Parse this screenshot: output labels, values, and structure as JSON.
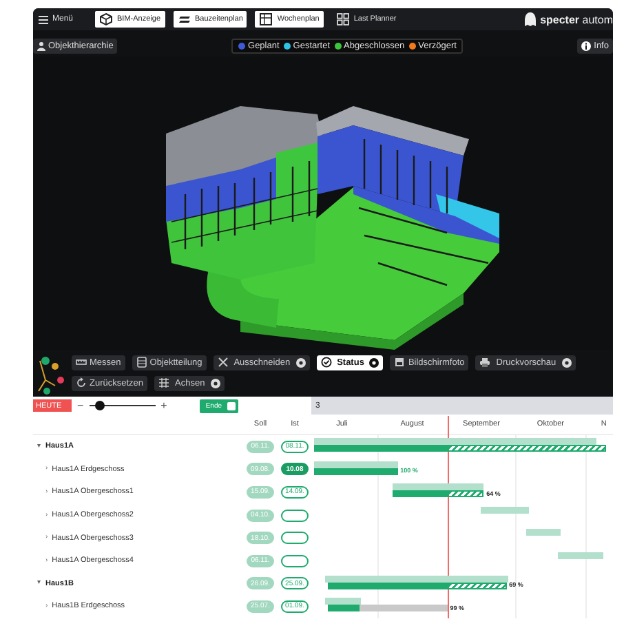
{
  "top_bar": {
    "menu_label": "Menü",
    "tabs": [
      {
        "label": "BIM-Anzeige",
        "selected": true
      },
      {
        "label": "Bauzeitenplan",
        "selected": true
      },
      {
        "label": "Wochenplan",
        "selected": true
      },
      {
        "label": "Last Planner",
        "selected": false
      }
    ],
    "logo_text": "**specter** autom"
  },
  "viewer": {
    "hierarchy_button": "Objekthierarchie",
    "legend": [
      {
        "label": "Geplant",
        "color": "#3d5bd6"
      },
      {
        "label": "Gestartet",
        "color": "#2ec4e6"
      },
      {
        "label": "Abgeschlossen",
        "color": "#3cc43c"
      },
      {
        "label": "Verzögert",
        "color": "#f07a1c"
      }
    ],
    "info_button": "Info",
    "tool_rows": [
      [
        {
          "label": "Messen",
          "selected": false,
          "options": false
        },
        {
          "label": "Objektteilung",
          "selected": false,
          "options": false
        },
        {
          "label": "Ausschneiden",
          "selected": false,
          "options": true
        },
        {
          "label": "Status",
          "selected": true,
          "options": true
        },
        {
          "label": "Bildschirmfoto",
          "selected": false,
          "options": false
        },
        {
          "label": "Druckvorschau",
          "selected": false,
          "options": true
        }
      ],
      [
        {
          "label": "Zurücksetzen",
          "selected": false,
          "options": false
        },
        {
          "label": "Achsen",
          "selected": false,
          "options": true
        }
      ]
    ]
  },
  "gantt": {
    "today_button": "HEUTE",
    "zoom": {
      "minus": "−",
      "plus": "+",
      "level": 0.17
    },
    "end_toggle": {
      "label": "Ende",
      "on": true
    },
    "year": "3",
    "columns": {
      "planned": "Soll",
      "actual": "Ist"
    },
    "rows": [
      {
        "toggle": "▾",
        "name": "Haus1A",
        "soll": "06.11.",
        "ist": {
          "kind": "forecast",
          "text": "08.11."
        },
        "children": [
          {
            "toggle": "›",
            "name": "Haus1A Erdgeschoss",
            "soll": "09.08.",
            "ist": {
              "kind": "done",
              "text": "10.08"
            },
            "percent": "100 %",
            "complete": true
          },
          {
            "toggle": "›",
            "name": "Haus1A Obergeschoss1",
            "soll": "15.09.",
            "ist": {
              "kind": "forecast",
              "text": "14.09."
            },
            "percent": "64 %",
            "complete": false
          },
          {
            "toggle": "›",
            "name": "Haus1A Obergeschoss2",
            "soll": "04.10.",
            "ist": {
              "kind": "open"
            }
          },
          {
            "toggle": "›",
            "name": "Haus1A Obergeschoss3",
            "soll": "18.10.",
            "ist": {
              "kind": "open"
            }
          },
          {
            "toggle": "›",
            "name": "Haus1A Obergeschoss4",
            "soll": "06.11.",
            "ist": {
              "kind": "open"
            }
          }
        ]
      },
      {
        "toggle": "▾",
        "name": "Haus1B",
        "soll": "26.09.",
        "ist": {
          "kind": "forecast",
          "text": "25.09."
        },
        "percent": "69 %",
        "complete": false,
        "children": [
          {
            "toggle": "›",
            "name": "Haus1B Erdgeschoss",
            "soll": "25.07.",
            "ist": {
              "kind": "forecast",
              "text": "01.09."
            },
            "percent": "99 %",
            "complete": false
          }
        ]
      }
    ],
    "months": [
      "Juli",
      "August",
      "September",
      "Oktober",
      "N"
    ]
  }
}
